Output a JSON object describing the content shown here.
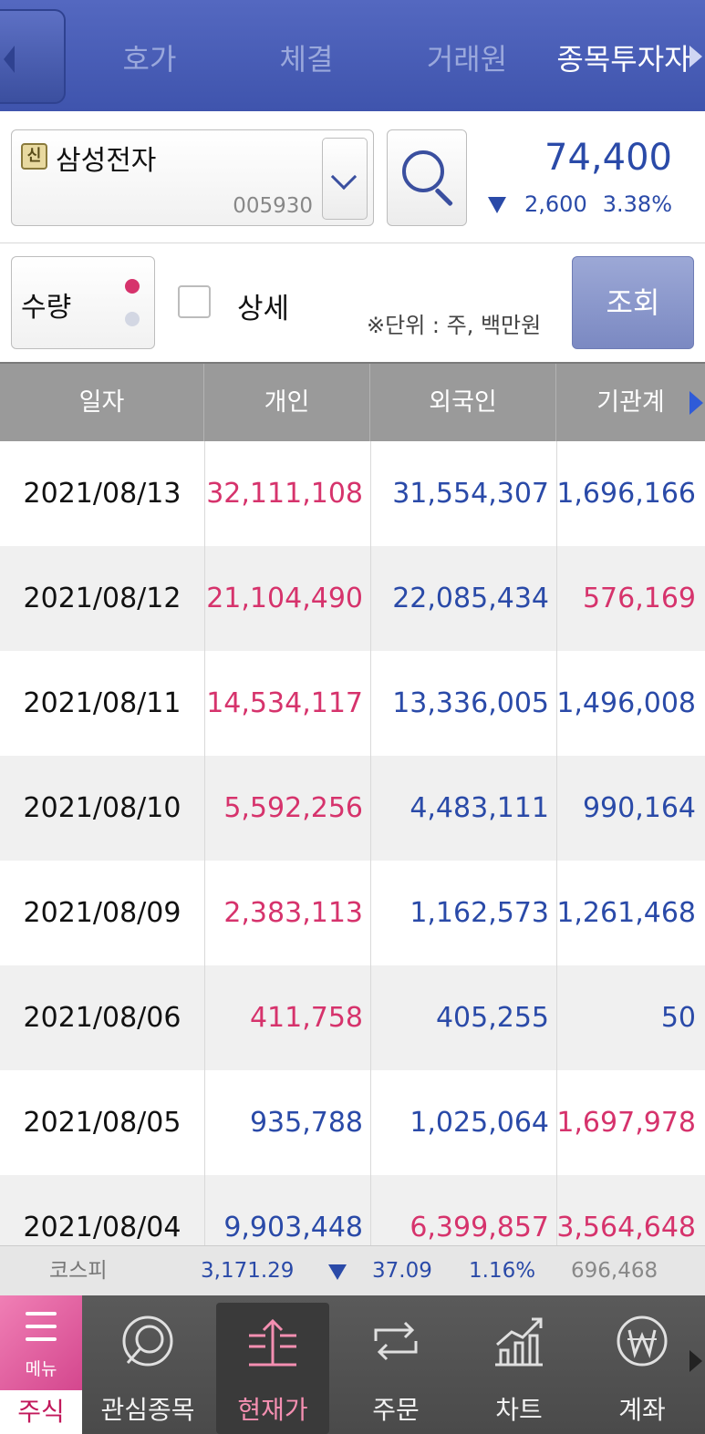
{
  "tabs": [
    {
      "label": "호가",
      "active": false
    },
    {
      "label": "체결",
      "active": false
    },
    {
      "label": "거래원",
      "active": false
    },
    {
      "label": "종목투자자",
      "active": true
    }
  ],
  "stock": {
    "badge": "신",
    "name": "삼성전자",
    "code": "005930",
    "price": "74,400",
    "change": "2,600",
    "change_pct": "3.38%",
    "direction": "down"
  },
  "options": {
    "qty_label": "수량",
    "detail_label": "상세",
    "detail_checked": false,
    "unit_note": "※단위 : 주, 백만원",
    "query_label": "조회"
  },
  "table": {
    "headers": [
      "일자",
      "개인",
      "외국인",
      "기관계"
    ],
    "rows": [
      {
        "date": "2021/08/13",
        "individual": "32,111,108",
        "foreign": "31,554,307",
        "institution": "1,696,166",
        "ind_color": "red",
        "for_color": "blue",
        "ins_color": "blue"
      },
      {
        "date": "2021/08/12",
        "individual": "21,104,490",
        "foreign": "22,085,434",
        "institution": "576,169",
        "ind_color": "red",
        "for_color": "blue",
        "ins_color": "red"
      },
      {
        "date": "2021/08/11",
        "individual": "14,534,117",
        "foreign": "13,336,005",
        "institution": "1,496,008",
        "ind_color": "red",
        "for_color": "blue",
        "ins_color": "blue"
      },
      {
        "date": "2021/08/10",
        "individual": "5,592,256",
        "foreign": "4,483,111",
        "institution": "990,164",
        "ind_color": "red",
        "for_color": "blue",
        "ins_color": "blue"
      },
      {
        "date": "2021/08/09",
        "individual": "2,383,113",
        "foreign": "1,162,573",
        "institution": "1,261,468",
        "ind_color": "red",
        "for_color": "blue",
        "ins_color": "blue"
      },
      {
        "date": "2021/08/06",
        "individual": "411,758",
        "foreign": "405,255",
        "institution": "50",
        "ind_color": "red",
        "for_color": "blue",
        "ins_color": "blue"
      },
      {
        "date": "2021/08/05",
        "individual": "935,788",
        "foreign": "1,025,064",
        "institution": "1,697,978",
        "ind_color": "blue",
        "for_color": "blue",
        "ins_color": "red"
      },
      {
        "date": "2021/08/04",
        "individual": "9,903,448",
        "foreign": "6,399,857",
        "institution": "3,564,648",
        "ind_color": "blue",
        "for_color": "red",
        "ins_color": "red"
      }
    ]
  },
  "index": {
    "name": "코스피",
    "value": "3,171.29",
    "change": "37.09",
    "change_pct": "1.16%",
    "volume": "696,468"
  },
  "bottom_nav": {
    "menu_label": "메뉴",
    "menu_sub": "주식",
    "items": [
      {
        "label": "관심종목",
        "icon": "star-circle-icon",
        "active": false
      },
      {
        "label": "현재가",
        "icon": "price-up-icon",
        "active": true
      },
      {
        "label": "주문",
        "icon": "repeat-icon",
        "active": false
      },
      {
        "label": "차트",
        "icon": "chart-icon",
        "active": false
      },
      {
        "label": "계좌",
        "icon": "won-icon",
        "active": false
      }
    ]
  },
  "colors": {
    "up": "#d6336c",
    "down": "#2a4aa8",
    "header_bg": "#3f54ad"
  }
}
